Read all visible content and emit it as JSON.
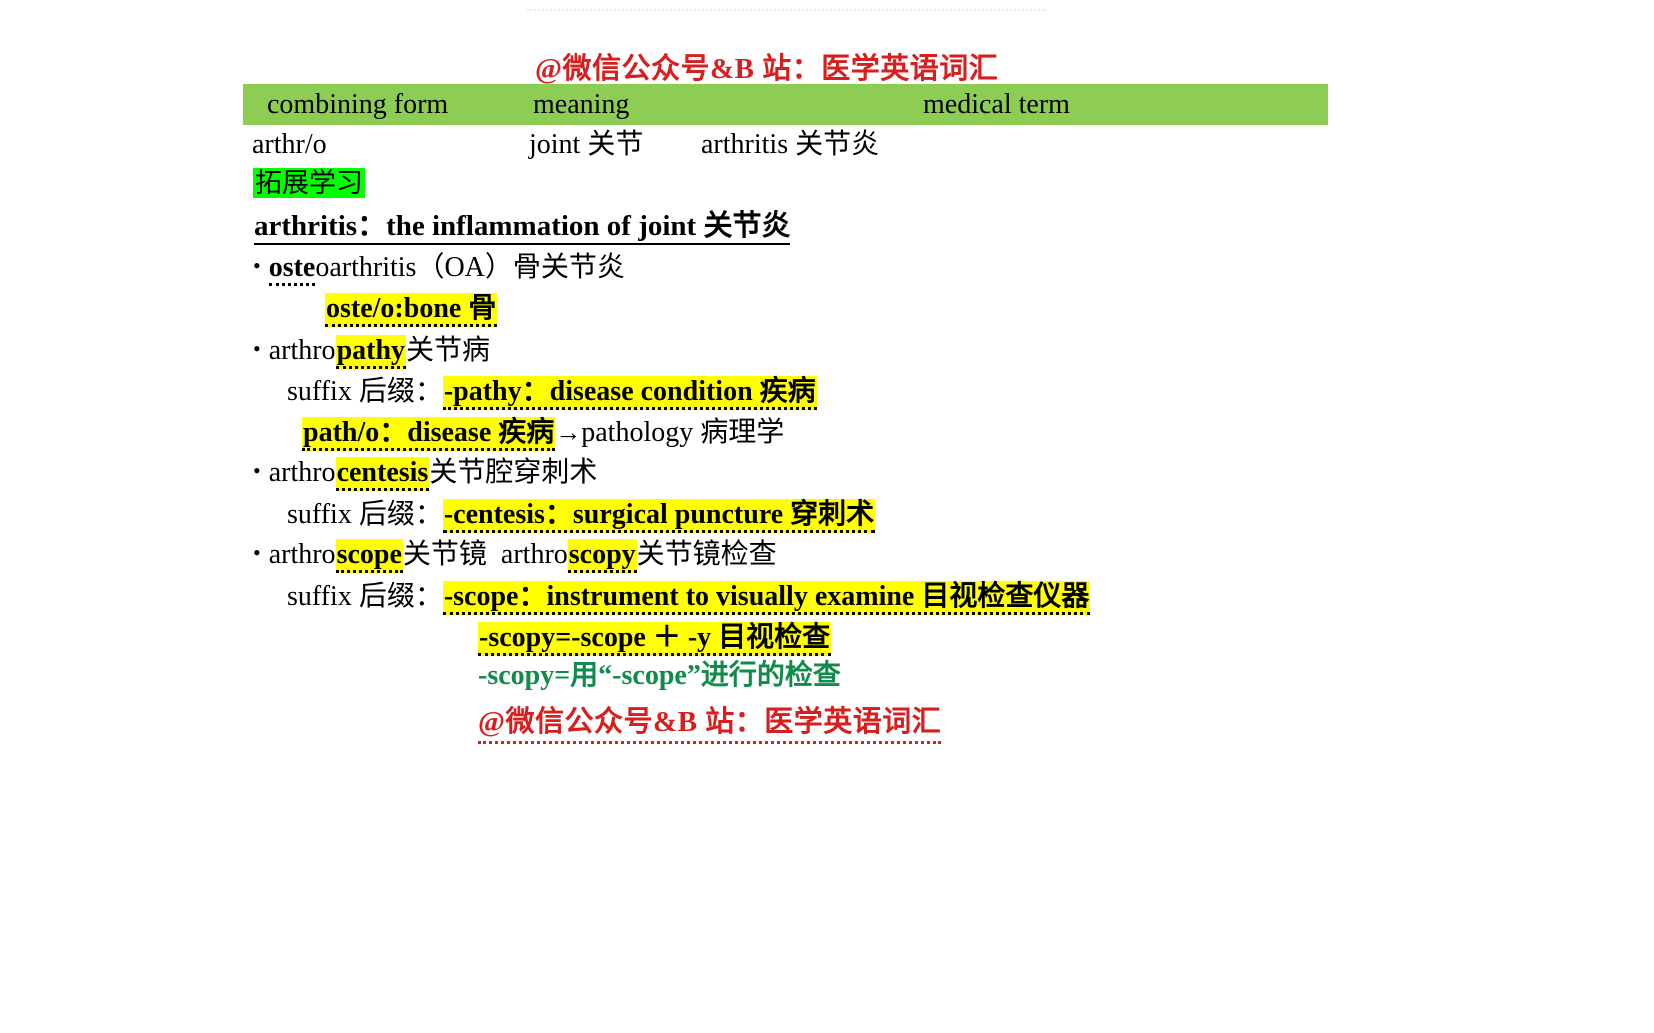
{
  "slide": {
    "watermark_top": "@微信公众号&B 站：医学英语词汇",
    "watermark_bottom": "@微信公众号&B 站：医学英语词汇",
    "watermark_color": "#d81f1f"
  },
  "table": {
    "header_bg": "#8ecd53",
    "headers": {
      "combining_form": "combining form",
      "meaning": "meaning",
      "medical_term": "medical term"
    },
    "rows": [
      {
        "combining_form": "arthr/o",
        "meaning": "joint 关节",
        "medical_term": "arthritis 关节炎"
      }
    ]
  },
  "extend": {
    "badge": "拓展学习",
    "badge_bg": "#00ff00",
    "definition": "arthritis：the inflammation of joint 关节炎",
    "entries": [
      {
        "prefix": "oste",
        "rest": "oarthritis（OA）骨关节炎",
        "sub": "oste/o:bone 骨"
      },
      {
        "prefix_plain": "arthro",
        "root": "pathy",
        "rest": "关节病",
        "suffix_label": "suffix 后缀：",
        "suffix_value": "-pathy：disease condition 疾病",
        "extra_left": "path/o：disease 疾病",
        "extra_arrow": "→",
        "extra_right": "pathology 病理学"
      },
      {
        "prefix_plain": "arthro",
        "root": "centesis",
        "rest": "关节腔穿刺术",
        "suffix_label": "suffix 后缀：",
        "suffix_value": "-centesis：surgical puncture 穿刺术"
      },
      {
        "prefix_plain": "arthro",
        "root": "scope",
        "rest": "关节镜",
        "prefix_plain2": "arthro",
        "root2": "scopy",
        "rest2": "关节镜检查",
        "suffix_label": "suffix 后缀：",
        "suffix_value": "-scope：instrument to visually examine 目视检查仪器",
        "equation": "-scopy=-scope ＋ -y 目视检查",
        "note": "-scopy=用“-scope”进行的检查",
        "note_color": "#118b4a"
      }
    ]
  }
}
